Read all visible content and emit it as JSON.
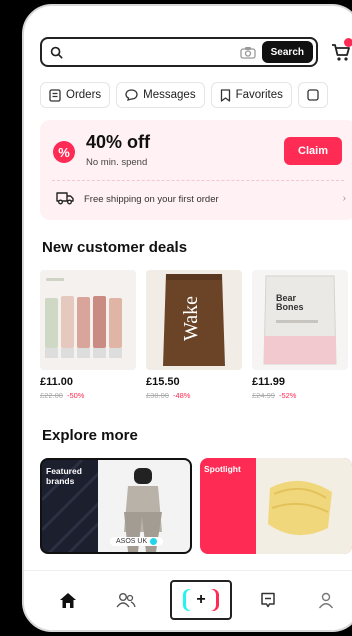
{
  "search": {
    "placeholder": "",
    "button_label": "Search"
  },
  "quick_links": [
    {
      "label": "Orders",
      "icon": "orders-icon"
    },
    {
      "label": "Messages",
      "icon": "messages-icon"
    },
    {
      "label": "Favorites",
      "icon": "bookmark-icon"
    }
  ],
  "coupon": {
    "title": "40% off",
    "subtitle": "No min. spend",
    "claim_label": "Claim",
    "shipping_text": "Free shipping on your first order"
  },
  "deals": {
    "title": "New customer deals",
    "products": [
      {
        "price": "£11.00",
        "original": "£22.00",
        "discount": "-50%"
      },
      {
        "price": "£15.50",
        "original": "£30.00",
        "discount": "-48%",
        "brand_text": "Wake"
      },
      {
        "price": "£11.99",
        "original": "£24.99",
        "discount": "-52%",
        "brand_text": "Bear Bones"
      }
    ]
  },
  "explore": {
    "title": "Explore more",
    "tiles": [
      {
        "label": "Featured brands",
        "caption": "ASOS UK"
      },
      {
        "label": "Spotlight"
      }
    ]
  },
  "nav": {
    "items": [
      "home-icon",
      "friends-icon",
      "create-icon",
      "inbox-icon",
      "profile-icon"
    ]
  },
  "colors": {
    "accent": "#fe2c55",
    "coupon_bg": "#fff1f4",
    "dark": "#111111"
  }
}
